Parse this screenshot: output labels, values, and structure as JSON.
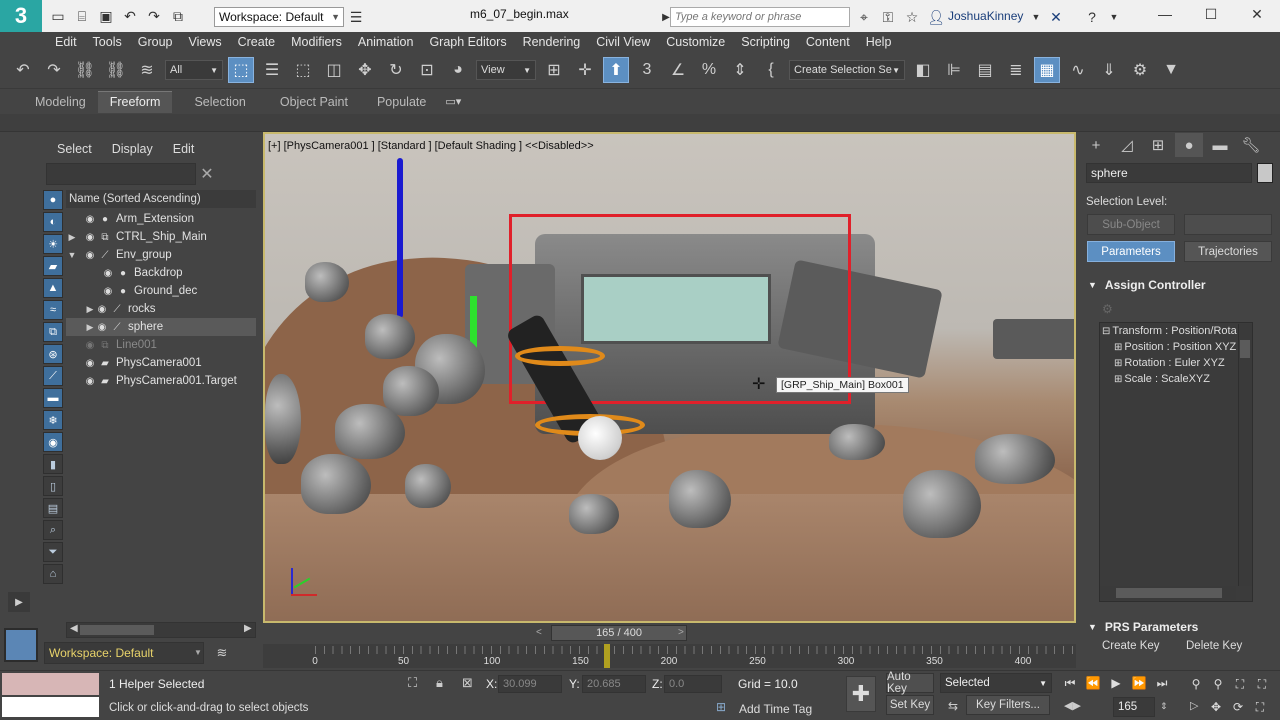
{
  "titlebar": {
    "logo": "3",
    "workspace": "Workspace: Default",
    "file_title": "m6_07_begin.max",
    "search_placeholder": "Type a keyword or phrase",
    "user": "JoshuaKinney"
  },
  "menubar": [
    "Edit",
    "Tools",
    "Group",
    "Views",
    "Create",
    "Modifiers",
    "Animation",
    "Graph Editors",
    "Rendering",
    "Civil View",
    "Customize",
    "Scripting",
    "Content",
    "Help"
  ],
  "toolbar": {
    "filter": "All",
    "ref_coord": "View",
    "selection_set": "Create Selection Se"
  },
  "ribbon": {
    "tabs": [
      "Modeling",
      "Freeform",
      "Selection",
      "Object Paint",
      "Populate"
    ],
    "active": "Freeform"
  },
  "explorer": {
    "menu": [
      "Select",
      "Display",
      "Edit"
    ],
    "header": "Name (Sorted Ascending)",
    "rows": [
      {
        "label": "Arm_Extension"
      },
      {
        "label": "CTRL_Ship_Main"
      },
      {
        "label": "Env_group"
      },
      {
        "label": "Backdrop"
      },
      {
        "label": "Ground_dec"
      },
      {
        "label": "rocks"
      },
      {
        "label": "sphere"
      },
      {
        "label": "Line001"
      },
      {
        "label": "PhysCamera001"
      },
      {
        "label": "PhysCamera001.Target"
      }
    ],
    "workspace": "Workspace: Default"
  },
  "viewport": {
    "label": "[+] [PhysCamera001 ] [Standard ] [Default Shading ]  <<Disabled>>",
    "tooltip": "[GRP_Ship_Main] Box001"
  },
  "cmdpanel": {
    "name": "sphere",
    "selection_level": "Selection Level:",
    "sub_object": "Sub-Object",
    "parameters": "Parameters",
    "trajectories": "Trajectories",
    "assign_controller": "Assign Controller",
    "controllers": [
      "Transform : Position/Rota",
      "Position : Position XYZ",
      "Rotation : Euler XYZ",
      "Scale : ScaleXYZ"
    ],
    "prs_title": "PRS Parameters",
    "create_key": "Create Key",
    "delete_key": "Delete Key"
  },
  "timeline": {
    "frame_display": "165 / 400",
    "ticks": [
      "0",
      "50",
      "100",
      "150",
      "200",
      "250",
      "300",
      "350",
      "400"
    ],
    "current_frame": 165,
    "total_frames": 400
  },
  "status": {
    "selected": "1 Helper Selected",
    "prompt": "Click or click-and-drag to select objects",
    "x_label": "X:",
    "x_value": "30.099",
    "y_label": "Y:",
    "y_value": "20.685",
    "z_label": "Z:",
    "z_value": "0.0",
    "grid": "Grid = 10.0",
    "add_time_tag": "Add Time Tag",
    "auto_key": "Auto Key",
    "set_key": "Set Key",
    "selected_dd": "Selected",
    "key_filters": "Key Filters...",
    "frame": "165"
  }
}
